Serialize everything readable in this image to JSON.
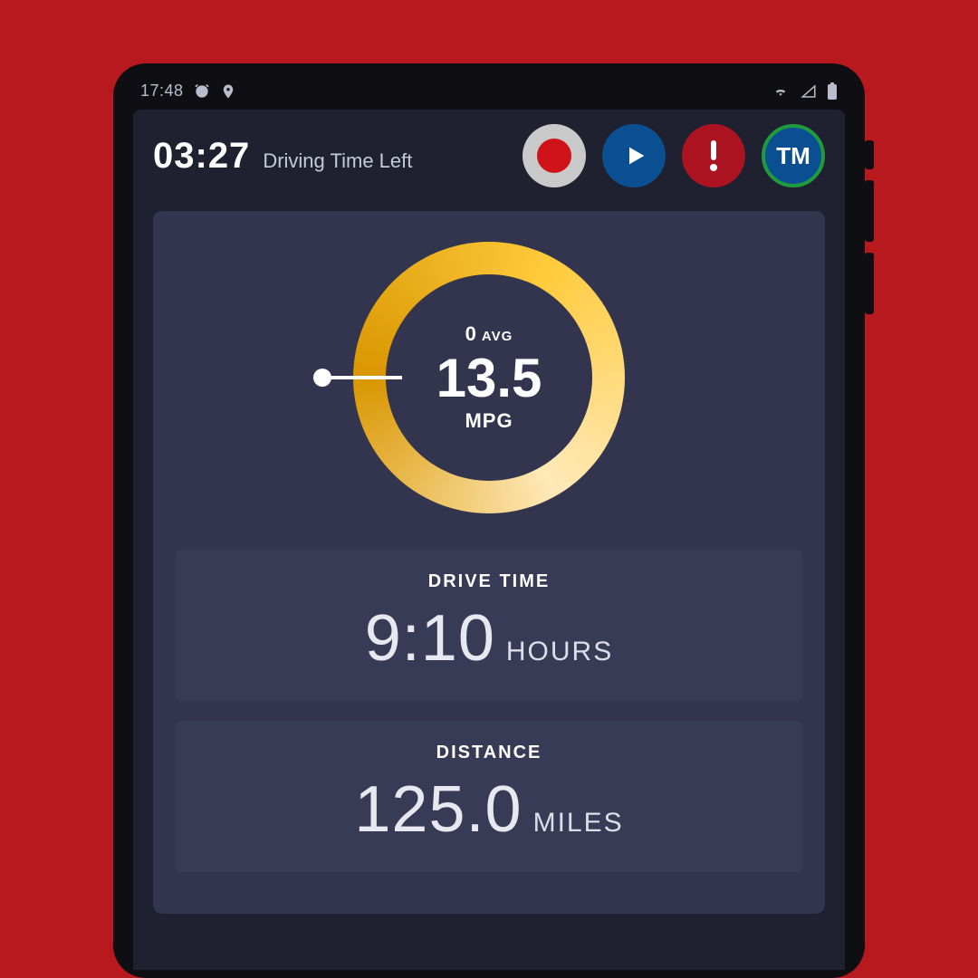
{
  "status": {
    "clock": "17:48"
  },
  "appbar": {
    "time_left_value": "03:27",
    "time_left_label": "Driving Time Left",
    "avatar_initials": "TM"
  },
  "gauge": {
    "avg_value": "0",
    "avg_label": "AVG",
    "value": "13.5",
    "unit": "MPG"
  },
  "stats": {
    "drive_time": {
      "title": "DRIVE TIME",
      "value": "9:10",
      "unit": "HOURS"
    },
    "distance": {
      "title": "DISTANCE",
      "value": "125.0",
      "unit": "MILES"
    }
  }
}
